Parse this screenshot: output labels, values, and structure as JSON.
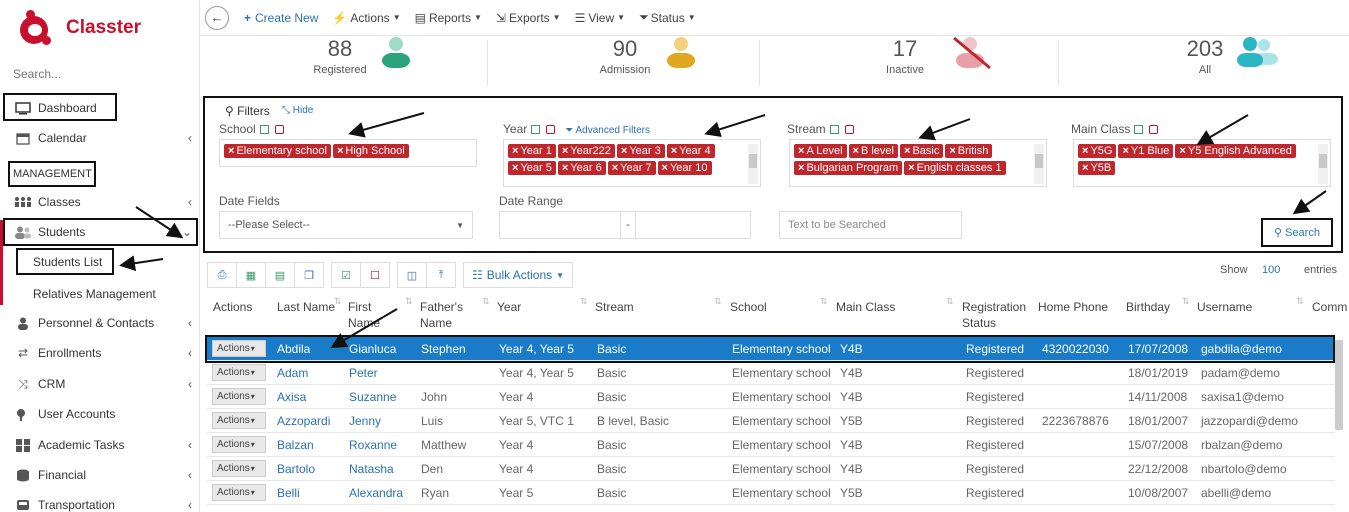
{
  "sidebar": {
    "brand": "Classter",
    "search_placeholder": "Search...",
    "dashboard": "Dashboard",
    "calendar": "Calendar",
    "section_management": "MANAGEMENT",
    "classes": "Classes",
    "students": "Students",
    "students_list": "Students List",
    "relatives": "Relatives Management",
    "personnel": "Personnel & Contacts",
    "enrollments": "Enrollments",
    "crm": "CRM",
    "user_accounts": "User Accounts",
    "academic_tasks": "Academic Tasks",
    "financial": "Financial",
    "transportation": "Transportation"
  },
  "toolbar": {
    "create_new": "Create New",
    "actions": "Actions",
    "reports": "Reports",
    "exports": "Exports",
    "view": "View",
    "status": "Status"
  },
  "stats": [
    {
      "value": "88",
      "label": "Registered",
      "color": "#2aa37a"
    },
    {
      "value": "90",
      "label": "Admission",
      "color": "#e0a820"
    },
    {
      "value": "17",
      "label": "Inactive",
      "color": "#e8a0a8"
    },
    {
      "value": "203",
      "label": "All",
      "color": "#2bb6c4"
    }
  ],
  "filters": {
    "title": "Filters",
    "hide": "Hide",
    "school_label": "School",
    "school_tags": [
      "Elementary school",
      "High School"
    ],
    "year_label": "Year",
    "advanced_filters": "Advanced Filters",
    "year_tags": [
      "Year 1",
      "Year222",
      "Year 3",
      "Year 4",
      "Year 5",
      "Year 6",
      "Year 7",
      "Year 10"
    ],
    "stream_label": "Stream",
    "stream_tags": [
      "A Level",
      "B level",
      "Basic",
      "British",
      "Bulgarian Program",
      "English classes 1"
    ],
    "mainclass_label": "Main Class",
    "mainclass_tags": [
      "Y5G",
      "Y1 Blue",
      "Y5 English Advanced",
      "Y5B"
    ],
    "date_fields_label": "Date Fields",
    "date_fields_value": "--Please Select--",
    "date_range_label": "Date Range",
    "date_range_sep": "-",
    "text_search_placeholder": "Text to be Searched",
    "search_button": "Search"
  },
  "table_tools": {
    "bulk_actions": "Bulk Actions",
    "show_label": "Show",
    "show_value": "100",
    "entries_label": "entries"
  },
  "table": {
    "columns": [
      "Actions",
      "Last Name",
      "First Name",
      "Father's Name",
      "Year",
      "Stream",
      "School",
      "Main Class",
      "Registration Status",
      "Home Phone",
      "Birthday",
      "Username",
      "Comm"
    ],
    "actions_label": "Actions",
    "rows": [
      {
        "last": "Abdila",
        "first": "Gianluca",
        "father": "Stephen",
        "year": "Year 4, Year 5",
        "stream": "Basic",
        "school": "Elementary school",
        "mainclass": "Y4B",
        "status": "Registered",
        "phone": "4320022030",
        "birthday": "17/07/2008",
        "username": "gabdila@demo"
      },
      {
        "last": "Adam",
        "first": "Peter",
        "father": "",
        "year": "Year 4, Year 5",
        "stream": "Basic",
        "school": "Elementary school",
        "mainclass": "Y4B",
        "status": "Registered",
        "phone": "",
        "birthday": "18/01/2019",
        "username": "padam@demo"
      },
      {
        "last": "Axisa",
        "first": "Suzanne",
        "father": "John",
        "year": "Year 4",
        "stream": "Basic",
        "school": "Elementary school",
        "mainclass": "Y4B",
        "status": "Registered",
        "phone": "",
        "birthday": "14/11/2008",
        "username": "saxisa1@demo"
      },
      {
        "last": "Azzopardi",
        "first": "Jenny",
        "father": "Luis",
        "year": "Year 5, VTC 1",
        "stream": "B level, Basic",
        "school": "Elementary school",
        "mainclass": "Y5B",
        "status": "Registered",
        "phone": "2223678876",
        "birthday": "18/01/2007",
        "username": "jazzopardi@demo"
      },
      {
        "last": "Balzan",
        "first": "Roxanne",
        "father": "Matthew",
        "year": "Year 4",
        "stream": "Basic",
        "school": "Elementary school",
        "mainclass": "Y4B",
        "status": "Registered",
        "phone": "",
        "birthday": "15/07/2008",
        "username": "rbalzan@demo"
      },
      {
        "last": "Bartolo",
        "first": "Natasha",
        "father": "Den",
        "year": "Year 4",
        "stream": "Basic",
        "school": "Elementary school",
        "mainclass": "Y4B",
        "status": "Registered",
        "phone": "",
        "birthday": "22/12/2008",
        "username": "nbartolo@demo"
      },
      {
        "last": "Belli",
        "first": "Alexandra",
        "father": "Ryan",
        "year": "Year 5",
        "stream": "Basic",
        "school": "Elementary school",
        "mainclass": "Y5B",
        "status": "Registered",
        "phone": "",
        "birthday": "10/08/2007",
        "username": "abelli@demo"
      }
    ]
  },
  "colors": {
    "brand": "#c8102e",
    "link": "#2a72b5",
    "selected_row": "#1a7cc9",
    "tag": "#c0272d"
  }
}
